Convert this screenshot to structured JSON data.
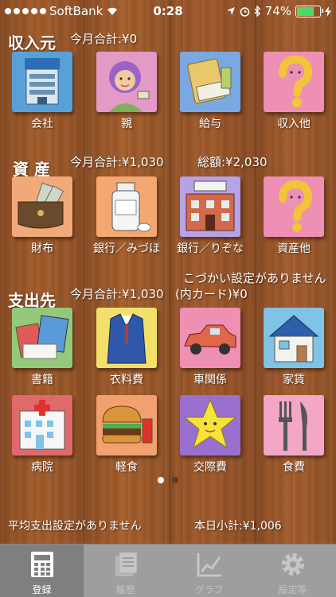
{
  "status": {
    "carrier": "SoftBank",
    "time": "0:28",
    "battery": "74%"
  },
  "income": {
    "title": "収入元",
    "monthly_total": "今月合計:¥0",
    "items": [
      {
        "label": "会社",
        "icon": "company-building-icon",
        "color": "#5aa0d8"
      },
      {
        "label": "親",
        "icon": "mother-icon",
        "color": "#e39ac6"
      },
      {
        "label": "給与",
        "icon": "pay-envelope-icon",
        "color": "#7aa8e0"
      },
      {
        "label": "収入他",
        "icon": "question-mark-icon",
        "color": "#ee8fb4"
      }
    ]
  },
  "assets": {
    "title": "資 産",
    "monthly_total": "今月合計:¥1,030",
    "grand_total": "総額:¥2,030",
    "items": [
      {
        "label": "財布",
        "icon": "wallet-icon",
        "color": "#f2a97a"
      },
      {
        "label": "銀行／みづほ",
        "icon": "drug-bottle-icon",
        "color": "#f4a870"
      },
      {
        "label": "銀行／りぞな",
        "icon": "bank-icon",
        "color": "#b6a2e6"
      },
      {
        "label": "資産他",
        "icon": "question-mark-icon",
        "color": "#ee8fb4"
      }
    ]
  },
  "allowance_notice": "こづかい設定がありません",
  "expenses": {
    "title": "支出先",
    "monthly_total": "今月合計:¥1,030",
    "card_total": "(内カード)¥0",
    "items": [
      {
        "label": "書籍",
        "icon": "books-icon",
        "color": "#95c97a"
      },
      {
        "label": "衣料費",
        "icon": "suit-icon",
        "color": "#f3e06a"
      },
      {
        "label": "車関係",
        "icon": "car-icon",
        "color": "#ee8fb4"
      },
      {
        "label": "家賃",
        "icon": "house-icon",
        "color": "#7fc3e6"
      },
      {
        "label": "病院",
        "icon": "hospital-icon",
        "color": "#e06a6a"
      },
      {
        "label": "軽食",
        "icon": "burger-icon",
        "color": "#f2a070"
      },
      {
        "label": "交際費",
        "icon": "star-icon",
        "color": "#9a6fd0"
      },
      {
        "label": "食費",
        "icon": "fork-knife-icon",
        "color": "#f3a6c6"
      }
    ]
  },
  "footer": {
    "avg_notice": "平均支出設定がありません",
    "today_subtotal": "本日小計:¥1,006"
  },
  "pager": {
    "active_page": 1,
    "page_count": 2
  },
  "tabbar": [
    {
      "label": "登録",
      "icon": "calculator-icon"
    },
    {
      "label": "履歴",
      "icon": "history-icon"
    },
    {
      "label": "グラフ",
      "icon": "chart-icon"
    },
    {
      "label": "設定等",
      "icon": "gear-icon"
    }
  ]
}
